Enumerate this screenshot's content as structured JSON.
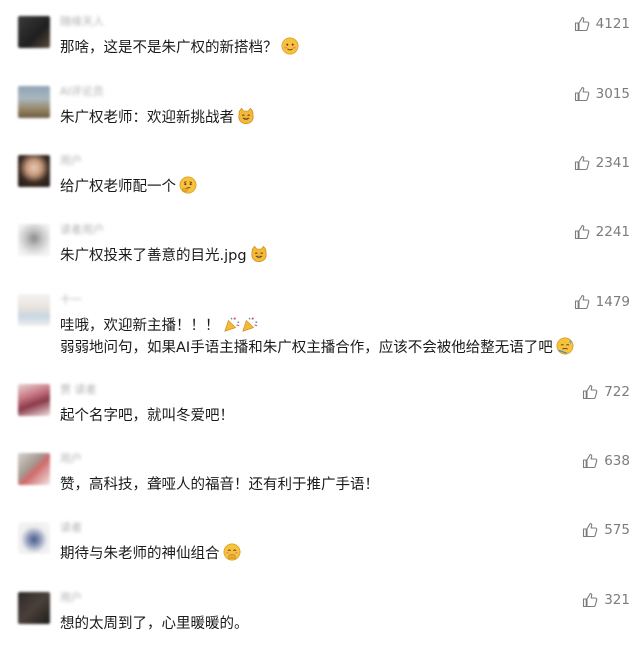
{
  "colors": {
    "text": "#1a1a1a",
    "username": "#b2b2b2",
    "likes": "#7c7c7c",
    "background": "#ffffff"
  },
  "comments": [
    {
      "username": "随缘天人",
      "text": [
        "那啥，这是不是朱广权的新搭档？"
      ],
      "emoji": "blush-face-emoji",
      "likes": "4121"
    },
    {
      "username": "AI评论员",
      "text": [
        "朱广权老师：欢迎新挑战者"
      ],
      "emoji": "cat-face-emoji",
      "likes": "3015"
    },
    {
      "username": "用户",
      "text": [
        "给广权老师配一个"
      ],
      "emoji": "thinking-face-emoji",
      "likes": "2341"
    },
    {
      "username": "读者用户",
      "text": [
        "朱广权投来了善意的目光.jpg"
      ],
      "emoji": "cat-face-emoji",
      "likes": "2241"
    },
    {
      "username": "十一",
      "text": [
        "哇哦，欢迎新主播！！！",
        "弱弱地问句，如果AI手语主播和朱广权主播合作，应该不会被他给整无语了吧"
      ],
      "emoji": "party-popper-emoji",
      "emoji2": "sweat-face-emoji",
      "likes": "1479"
    },
    {
      "username": "贾 读者",
      "text": [
        "起个名字吧，就叫冬爱吧！"
      ],
      "emoji": "",
      "likes": "722"
    },
    {
      "username": "用户",
      "text": [
        "赞，高科技，聋哑人的福音！还有利于推广手语！"
      ],
      "emoji": "",
      "likes": "638"
    },
    {
      "username": "读者",
      "text": [
        "期待与朱老师的神仙组合"
      ],
      "emoji": "hand-over-mouth-emoji",
      "likes": "575"
    },
    {
      "username": "用户",
      "text": [
        "想的太周到了，心里暖暖的。"
      ],
      "emoji": "",
      "likes": "321"
    }
  ]
}
